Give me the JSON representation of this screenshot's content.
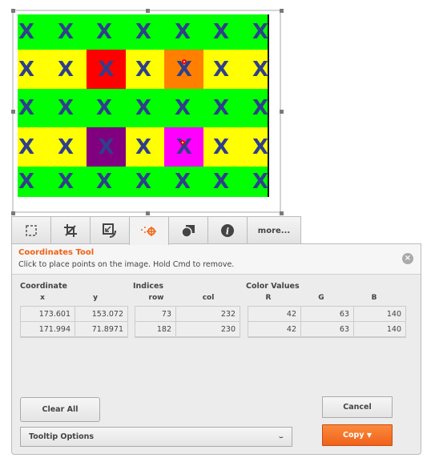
{
  "image": {
    "row_colors": [
      "#00ff00",
      "#ffff00",
      "#00ff00",
      "#ffff00",
      "#00ff00"
    ],
    "highlight_cells": [
      {
        "row": 1,
        "col": 2,
        "color": "#ff0000"
      },
      {
        "row": 1,
        "col": 4,
        "color": "#ff8000"
      },
      {
        "row": 3,
        "col": 2,
        "color": "#800080"
      },
      {
        "row": 3,
        "col": 4,
        "color": "#ff00ff"
      }
    ],
    "glyph": "X",
    "glyph_color": "#2f3f8c",
    "columns": 7
  },
  "tabs": [
    {
      "icon": "marquee-select-icon"
    },
    {
      "icon": "crop-icon"
    },
    {
      "icon": "resize-rotate-icon"
    },
    {
      "icon": "coordinates-icon",
      "active": true
    },
    {
      "icon": "shapes-icon"
    },
    {
      "icon": "info-icon"
    },
    {
      "label": "more..."
    }
  ],
  "panel": {
    "title": "Coordinates Tool",
    "subtitle": "Click to place points on the image. Hold Cmd to remove.",
    "coordinate_label": "Coordinate",
    "indices_label": "Indices",
    "color_label": "Color Values",
    "cols": {
      "x": "x",
      "y": "y",
      "row": "row",
      "col": "col",
      "r": "R",
      "g": "G",
      "b": "B"
    },
    "points": [
      {
        "x": "173.601",
        "y": "153.072",
        "row": "73",
        "col": "232",
        "r": "42",
        "g": "63",
        "b": "140"
      },
      {
        "x": "171.994",
        "y": "71.8971",
        "row": "182",
        "col": "230",
        "r": "42",
        "g": "63",
        "b": "140"
      }
    ]
  },
  "buttons": {
    "clear_all": "Clear All",
    "tooltip_options": "Tooltip Options",
    "cancel": "Cancel",
    "copy": "Copy"
  },
  "accent": "#f26a1b"
}
